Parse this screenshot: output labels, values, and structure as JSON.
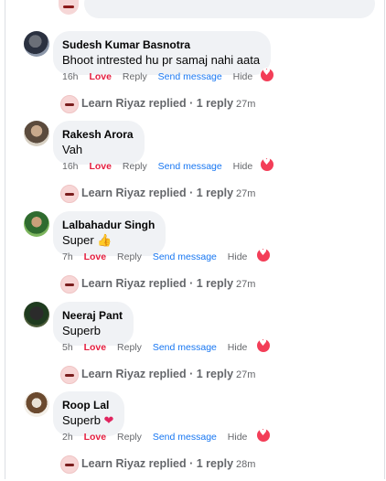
{
  "comments": [
    {
      "name": "Sudesh Kumar Basnotra",
      "text": "Bhoot intrested hu pr samaj nahi aata",
      "time": "16h",
      "reply_summary": "Learn Riyaz replied · 1 reply",
      "reply_time": "27m"
    },
    {
      "name": "Rakesh Arora",
      "text": "Vah",
      "time": "16h",
      "reply_summary": "Learn Riyaz replied · 1 reply",
      "reply_time": "27m"
    },
    {
      "name": "Lalbahadur Singh",
      "text": "Super",
      "emoji": "👍",
      "time": "7h",
      "reply_summary": "Learn Riyaz replied · 1 reply",
      "reply_time": "27m"
    },
    {
      "name": "Neeraj Pant",
      "text": "Superb",
      "time": "5h",
      "reply_summary": "Learn Riyaz replied · 1 reply",
      "reply_time": "27m"
    },
    {
      "name": "Roop Lal",
      "text": "Superb",
      "emoji": "❤",
      "time": "2h",
      "reply_summary": "Learn Riyaz replied · 1 reply",
      "reply_time": "28m"
    }
  ],
  "actions": {
    "love": "Love",
    "reply": "Reply",
    "send_message": "Send message",
    "hide": "Hide"
  },
  "colors": {
    "love": "#e41e3f",
    "link": "#1877f2",
    "bubble": "#f0f2f5",
    "heart_reaction": "#f33e58"
  }
}
